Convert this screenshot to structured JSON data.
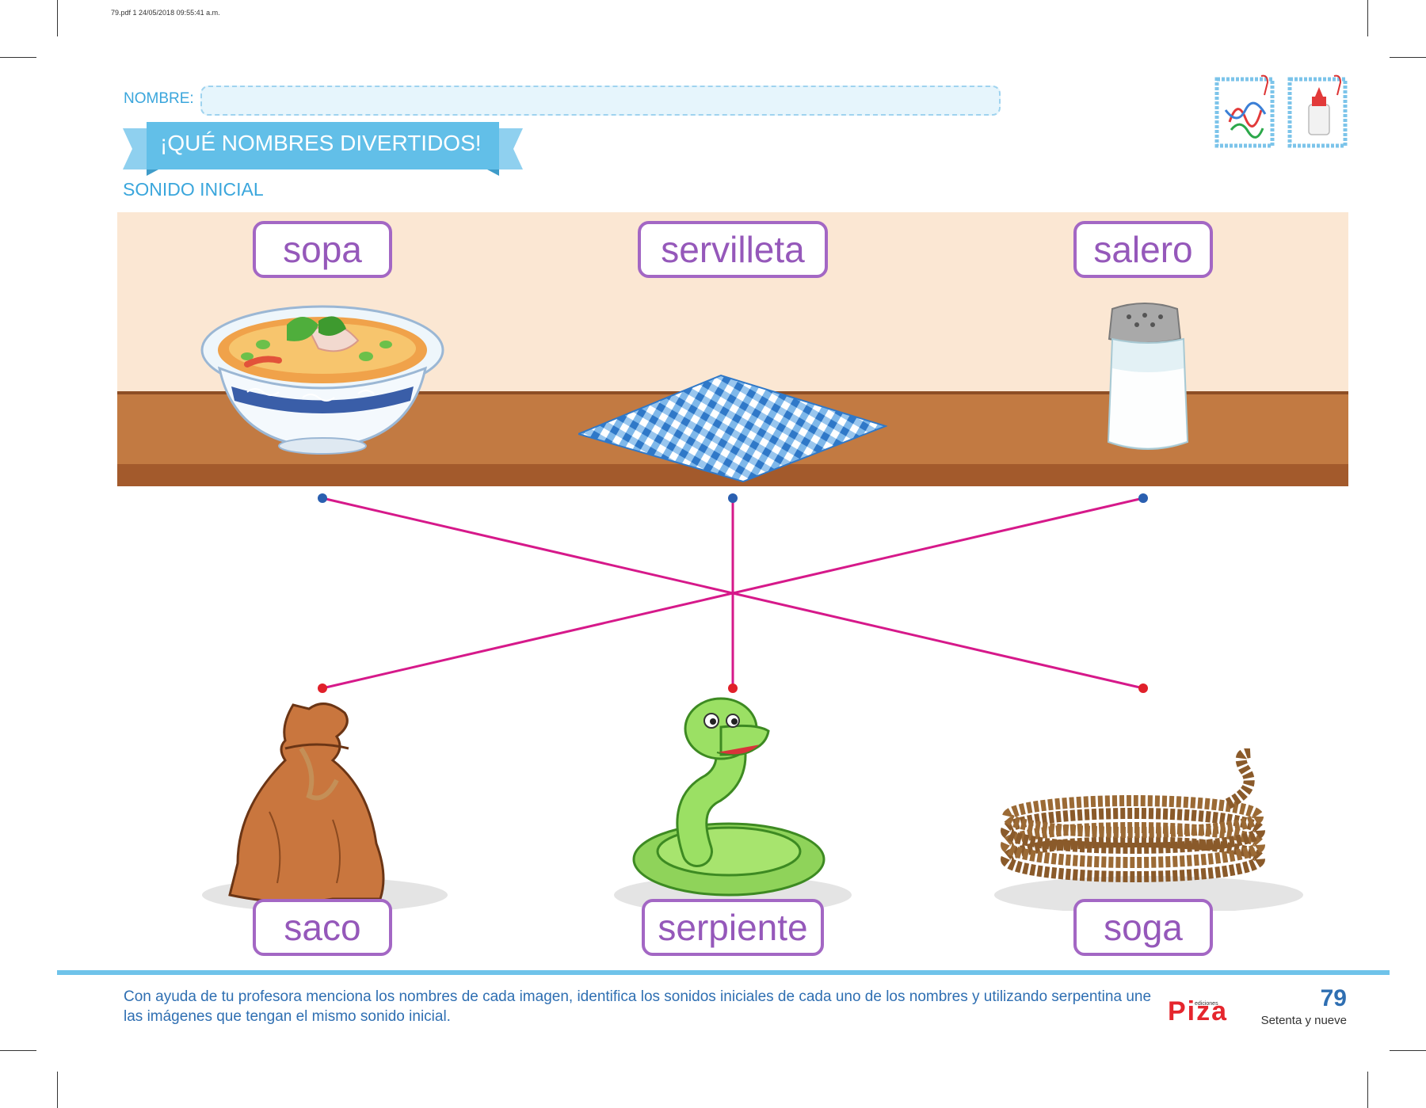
{
  "pdf_header": "79.pdf   1   24/05/2018   09:55:41 a.m.",
  "name_label": "NOMBRE:",
  "title": "¡QUÉ NOMBRES DIVERTIDOS!",
  "subtitle": "SONIDO INICIAL",
  "top_words": [
    "sopa",
    "servilleta",
    "salero"
  ],
  "bottom_words": [
    "saco",
    "serpiente",
    "soga"
  ],
  "top_items": [
    "soup-bowl",
    "checkered-napkin",
    "salt-shaker"
  ],
  "bottom_items": [
    "sack",
    "snake",
    "rope"
  ],
  "materials_icons": [
    "streamer-icon",
    "glue-icon"
  ],
  "instructions": "Con ayuda de tu profesora menciona los nombres de cada imagen, identifica los sonidos iniciales de cada uno de los nombres y utilizando serpentina une las imágenes que tengan el mismo sonido inicial.",
  "brand": {
    "name": "Piza",
    "sub": "ediciones"
  },
  "page": {
    "number": "79",
    "words": "Setenta y nueve"
  },
  "colors": {
    "accent_blue": "#3aa6dc",
    "word_purple": "#9558ba",
    "connector_line": "#d6198a",
    "dot_top": "#2a5fb0",
    "dot_bottom": "#e0202a",
    "counter_wall": "#fbe7d3",
    "counter_wood": "#c27a42"
  },
  "connections": [
    [
      "sopa",
      "soga"
    ],
    [
      "servilleta",
      "serpiente"
    ],
    [
      "salero",
      "saco"
    ]
  ]
}
